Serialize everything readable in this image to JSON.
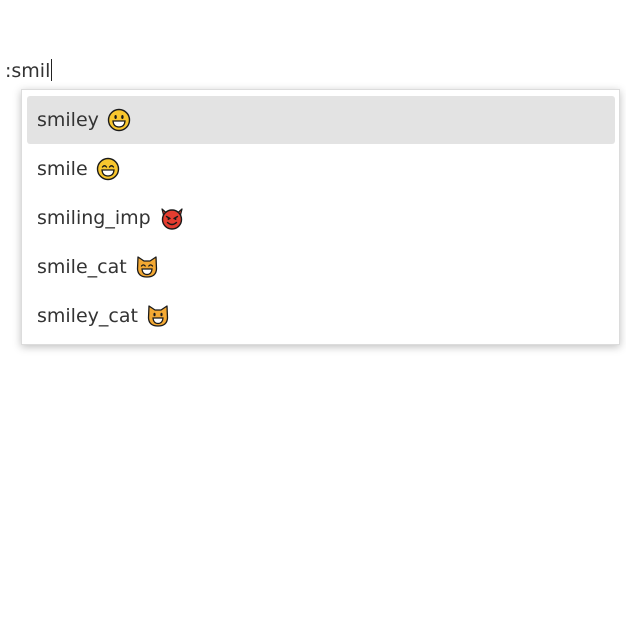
{
  "editor": {
    "typed_text": ":smil"
  },
  "autocomplete": {
    "items": [
      {
        "label": "smiley",
        "emoji": "smiley-face-icon",
        "selected": true
      },
      {
        "label": "smile",
        "emoji": "smile-face-icon",
        "selected": false
      },
      {
        "label": "smiling_imp",
        "emoji": "smiling-imp-icon",
        "selected": false
      },
      {
        "label": "smile_cat",
        "emoji": "smile-cat-icon",
        "selected": false
      },
      {
        "label": "smiley_cat",
        "emoji": "smiley-cat-icon",
        "selected": false
      }
    ]
  },
  "colors": {
    "selected_background": "#e3e3e3",
    "text": "#333333",
    "emoji_yellow": "#f8c62e",
    "emoji_red": "#e43d30",
    "cat_orange": "#f4a933"
  }
}
